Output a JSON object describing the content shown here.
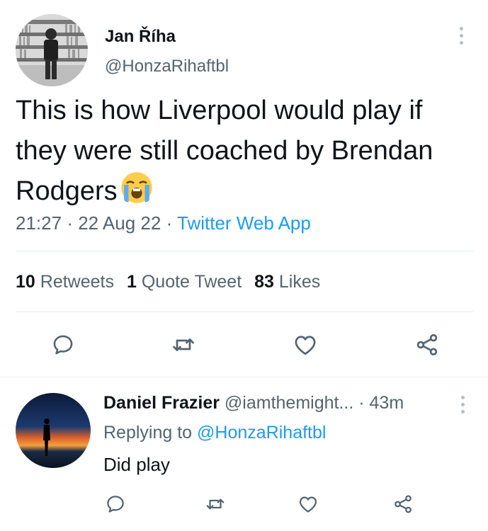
{
  "tweet": {
    "author_name": "Jan Říha",
    "author_handle": "@HonzaRihaftbl",
    "text": "This is how Liverpool would play if they were still coached by Brendan Rodgers",
    "emoji": "loudly-crying-face",
    "time": "21:27",
    "date": "22 Aug 22",
    "source_app": "Twitter Web App",
    "meta_separator": "·",
    "stats": {
      "retweets_count": "10",
      "retweets_label": "Retweets",
      "quotes_count": "1",
      "quotes_label": "Quote Tweet",
      "likes_count": "83",
      "likes_label": "Likes"
    },
    "actions": [
      "reply-icon",
      "retweet-icon",
      "like-icon",
      "share-icon"
    ]
  },
  "reply": {
    "author_name": "Daniel Frazier",
    "author_handle": "@iamthemight...",
    "separator": "·",
    "age": "43m",
    "replying_prefix": "Replying to",
    "replying_to": "@HonzaRihaftbl",
    "text": "Did play",
    "actions": [
      "reply-icon",
      "retweet-icon",
      "like-icon",
      "share-icon"
    ]
  },
  "colors": {
    "text": "#0f1419",
    "secondary": "#536471",
    "link": "#1d9bf0",
    "divider": "#e6ecf0",
    "icon": "#536471"
  }
}
